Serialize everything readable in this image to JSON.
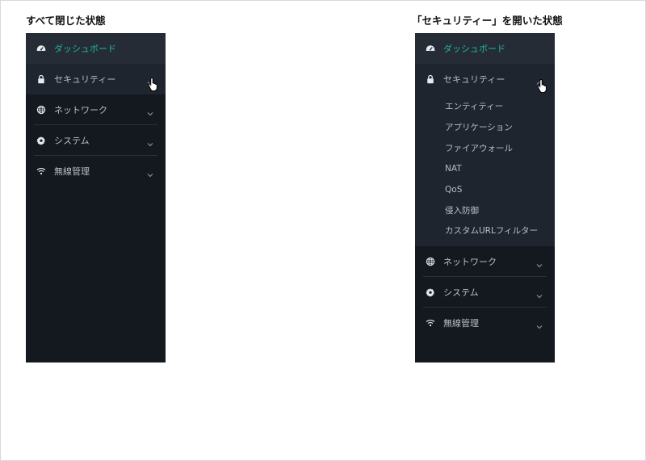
{
  "captions": {
    "left": "すべて閉じた状態",
    "right": "「セキュリティー」を開いた状態"
  },
  "menu": {
    "dashboard": {
      "label": "ダッシュボード",
      "icon": "speedometer-icon"
    },
    "security": {
      "label": "セキュリティー",
      "icon": "lock-icon"
    },
    "network": {
      "label": "ネットワーク",
      "icon": "globe-icon"
    },
    "system": {
      "label": "システム",
      "icon": "gear-icon"
    },
    "wireless": {
      "label": "無線管理",
      "icon": "wifi-icon"
    }
  },
  "security_submenu": [
    "エンティティー",
    "アプリケーション",
    "ファイアウォール",
    "NAT",
    "QoS",
    "侵入防御",
    "カスタムURLフィルター"
  ],
  "colors": {
    "sidebar_bg": "#141920",
    "active_bg": "#1f252e",
    "accent": "#22b5a0",
    "text": "#b8bdc5"
  }
}
